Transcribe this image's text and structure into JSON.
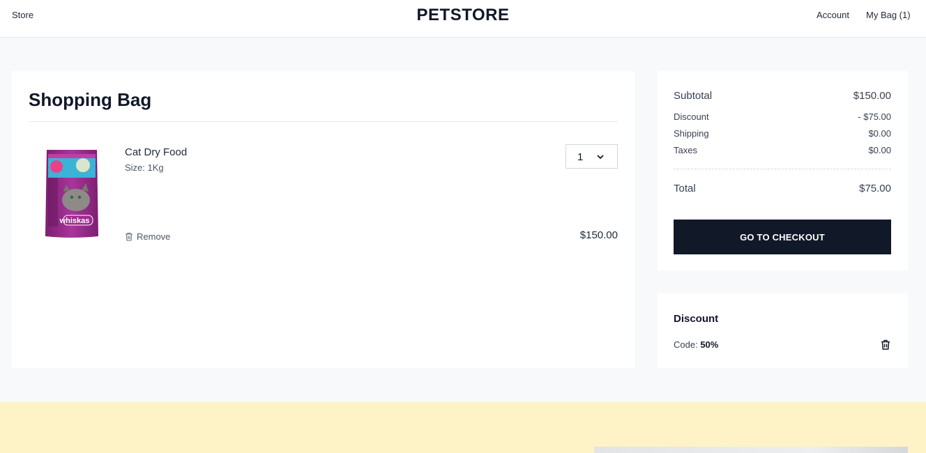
{
  "header": {
    "store_label": "Store",
    "brand": "PETSTORE",
    "account_label": "Account",
    "bag_label": "My Bag (1)"
  },
  "bag": {
    "title": "Shopping Bag",
    "items": [
      {
        "name": "Cat Dry Food",
        "size": "Size: 1Kg",
        "quantity": "1",
        "price": "$150.00",
        "remove_label": "Remove",
        "image_brand_text": "whiskas"
      }
    ]
  },
  "summary": {
    "subtotal_label": "Subtotal",
    "subtotal_value": "$150.00",
    "discount_label": "Discount",
    "discount_value": "- $75.00",
    "shipping_label": "Shipping",
    "shipping_value": "$0.00",
    "taxes_label": "Taxes",
    "taxes_value": "$0.00",
    "total_label": "Total",
    "total_value": "$75.00",
    "checkout_label": "GO TO CHECKOUT"
  },
  "discount": {
    "title": "Discount",
    "code_label": "Code:",
    "code_value": "50%"
  },
  "colors": {
    "primary_button": "#111827",
    "footer_band": "#fef3c7",
    "page_bg": "#f8f9fb",
    "product_purple": "#9b2f8c"
  },
  "icons": {
    "remove": "trash-icon",
    "quantity_dropdown": "chevron-down-icon",
    "discount_remove": "trash-icon"
  }
}
